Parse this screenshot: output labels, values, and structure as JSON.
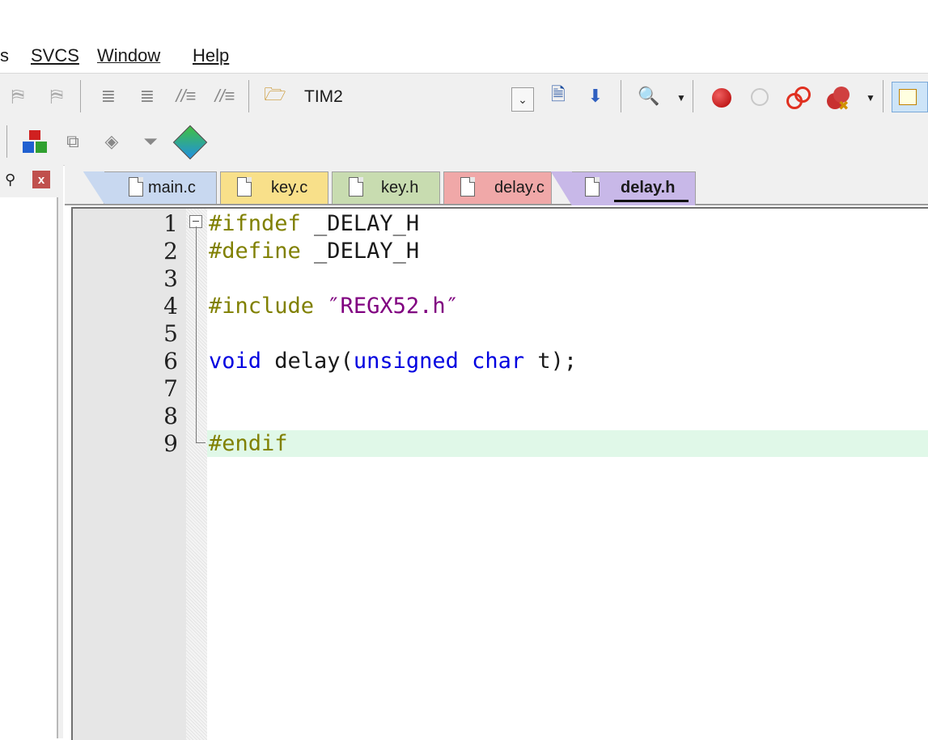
{
  "menu": {
    "items": [
      {
        "label": "s",
        "underline": ""
      },
      {
        "label": "SVCS",
        "underline": "S"
      },
      {
        "label": "Window",
        "underline": "W"
      },
      {
        "label": "Help",
        "underline": "H"
      }
    ]
  },
  "toolbar": {
    "target_name": "TIM2"
  },
  "tabs": [
    {
      "label": "main.c",
      "color": "#c8d8f0",
      "active": false
    },
    {
      "label": "key.c",
      "color": "#f8e08a",
      "active": false
    },
    {
      "label": "key.h",
      "color": "#c8dcb0",
      "active": false
    },
    {
      "label": "delay.c",
      "color": "#f0a8a8",
      "active": false
    },
    {
      "label": "delay.h",
      "color": "#c8b8e8",
      "active": true
    }
  ],
  "editor": {
    "line_numbers": [
      "1",
      "2",
      "3",
      "4",
      "5",
      "6",
      "7",
      "8",
      "9"
    ],
    "current_line": 9,
    "lines": {
      "l1_dir": "#ifndef",
      "l1_rest": " _DELAY_H",
      "l2_dir": "#define",
      "l2_rest": " _DELAY_H",
      "l4_dir": "#include",
      "l4_str": " ″REGX52.h″",
      "l6_kw1": "void",
      "l6_mid": " delay(",
      "l6_kw2": "unsigned char",
      "l6_end": " t);",
      "l9_dir": "#endif"
    }
  },
  "colors": {
    "directive": "#808000",
    "keyword": "#0000e0",
    "string": "#800080",
    "current_line_bg": "#e0f8e8"
  }
}
